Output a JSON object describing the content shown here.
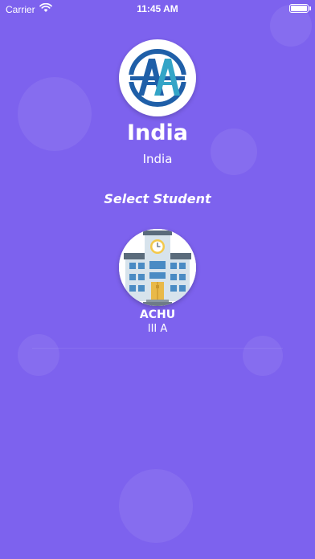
{
  "status_bar": {
    "carrier": "Carrier",
    "wifi_icon": "wifi-icon",
    "time": "11:45 AM",
    "battery_icon": "battery-icon",
    "battery_level_percent": 100
  },
  "school": {
    "logo_icon": "aa-logo-icon",
    "name": "India",
    "subtitle": "India"
  },
  "heading": "Select Student",
  "students": [
    {
      "avatar_icon": "school-building-icon",
      "name": "ACHU",
      "class": "III A"
    }
  ],
  "colors": {
    "background": "#7d62ee",
    "text": "#ffffff",
    "logo_blue": "#1f5fa8",
    "logo_teal": "#34a5c7"
  }
}
